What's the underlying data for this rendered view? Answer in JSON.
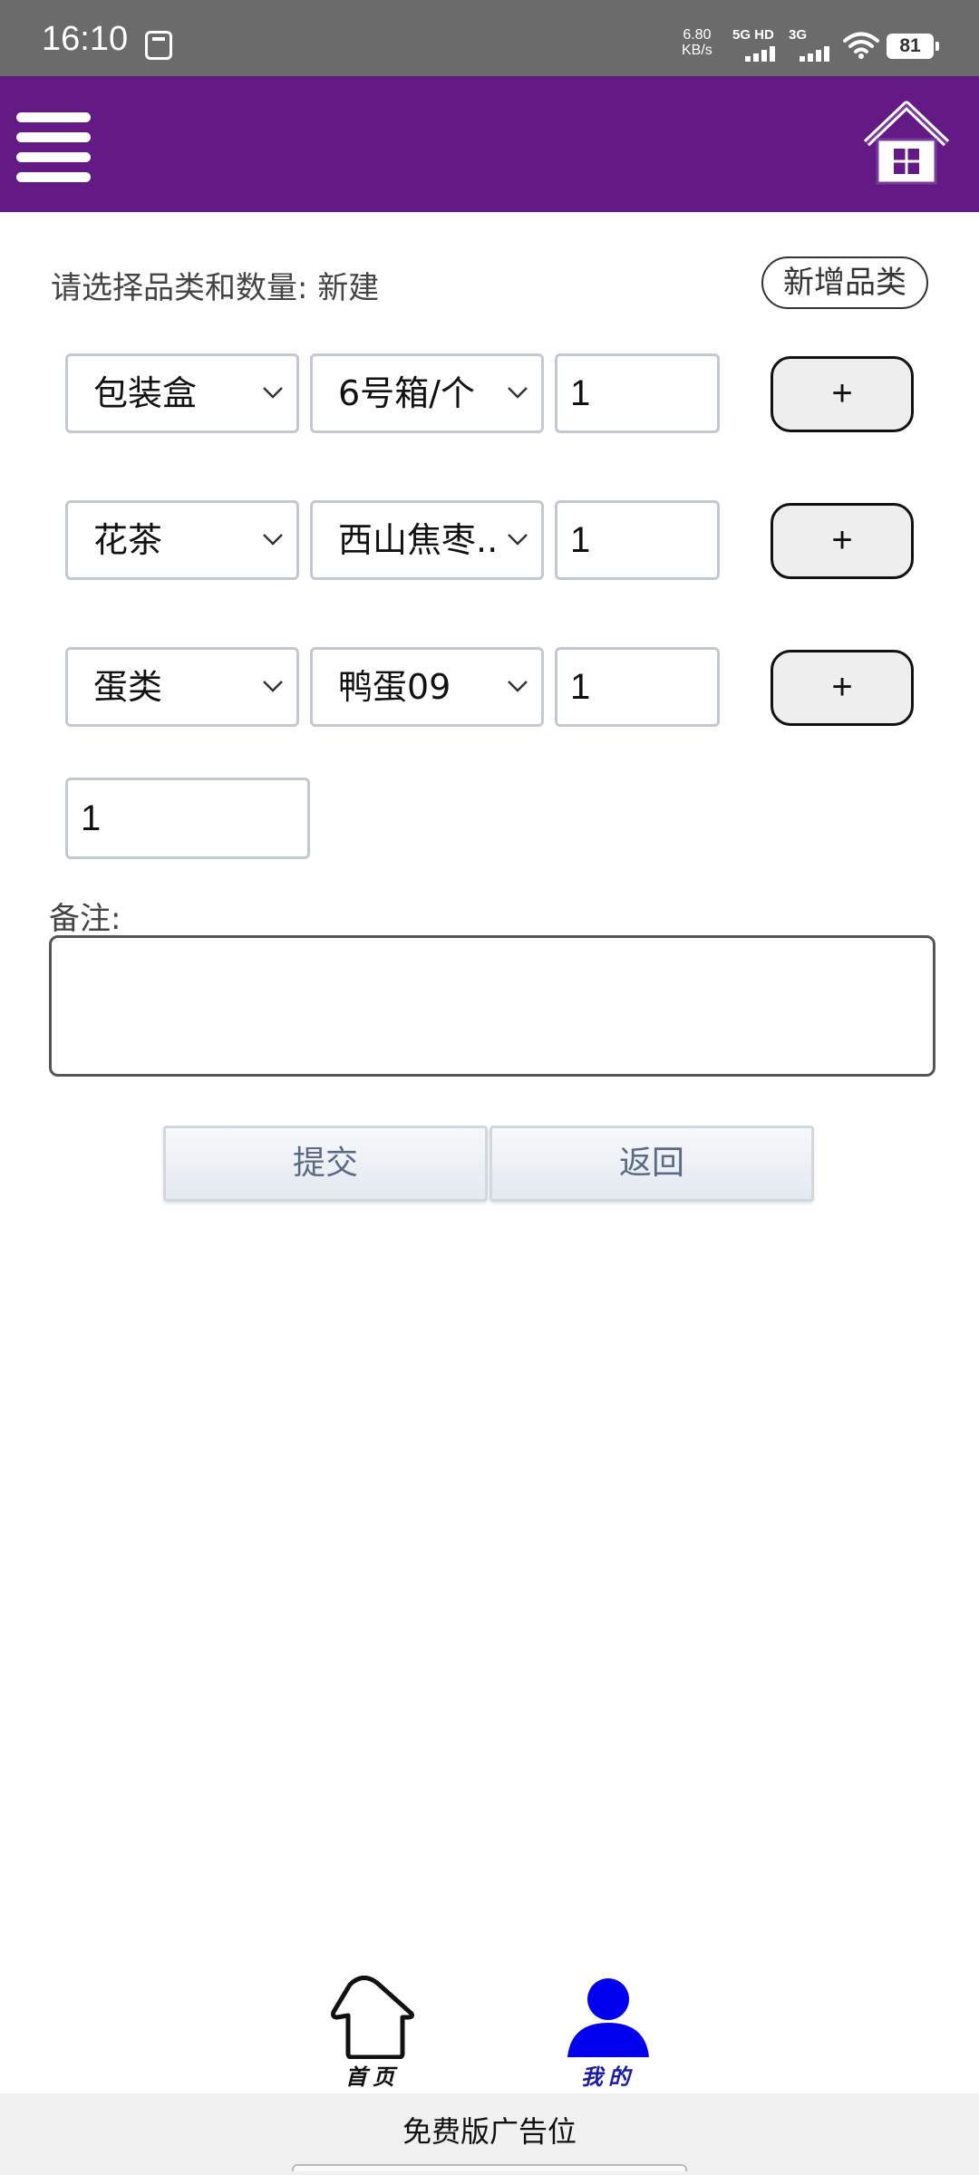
{
  "status_bar": {
    "time": "16:10",
    "net_speed_value": "6.80",
    "net_speed_unit": "KB/s",
    "sim1": "5G HD",
    "sim2": "3G",
    "battery": "81"
  },
  "app_bar": {
    "menu_icon": "hamburger-icon",
    "home_icon": "house-icon",
    "accent_color": "#641a84"
  },
  "form": {
    "prompt": "请选择品类和数量: 新建",
    "add_category_label": "新增品类",
    "rows": [
      {
        "category": "包装盒",
        "item": "6号箱/个",
        "quantity": "1",
        "add_label": "+"
      },
      {
        "category": "花茶",
        "item": "西山焦枣...",
        "quantity": "1",
        "add_label": "+"
      },
      {
        "category": "蛋类",
        "item": "鸭蛋09",
        "quantity": "1",
        "add_label": "+"
      }
    ],
    "extra_quantity": "1",
    "remark_label": "备注:",
    "remark_value": "",
    "submit_label": "提交",
    "back_label": "返回"
  },
  "bottom_nav": {
    "home_label": "首页",
    "mine_label": "我的",
    "active_color": "#0000ee"
  },
  "ad": {
    "text": "免费版广告位"
  }
}
